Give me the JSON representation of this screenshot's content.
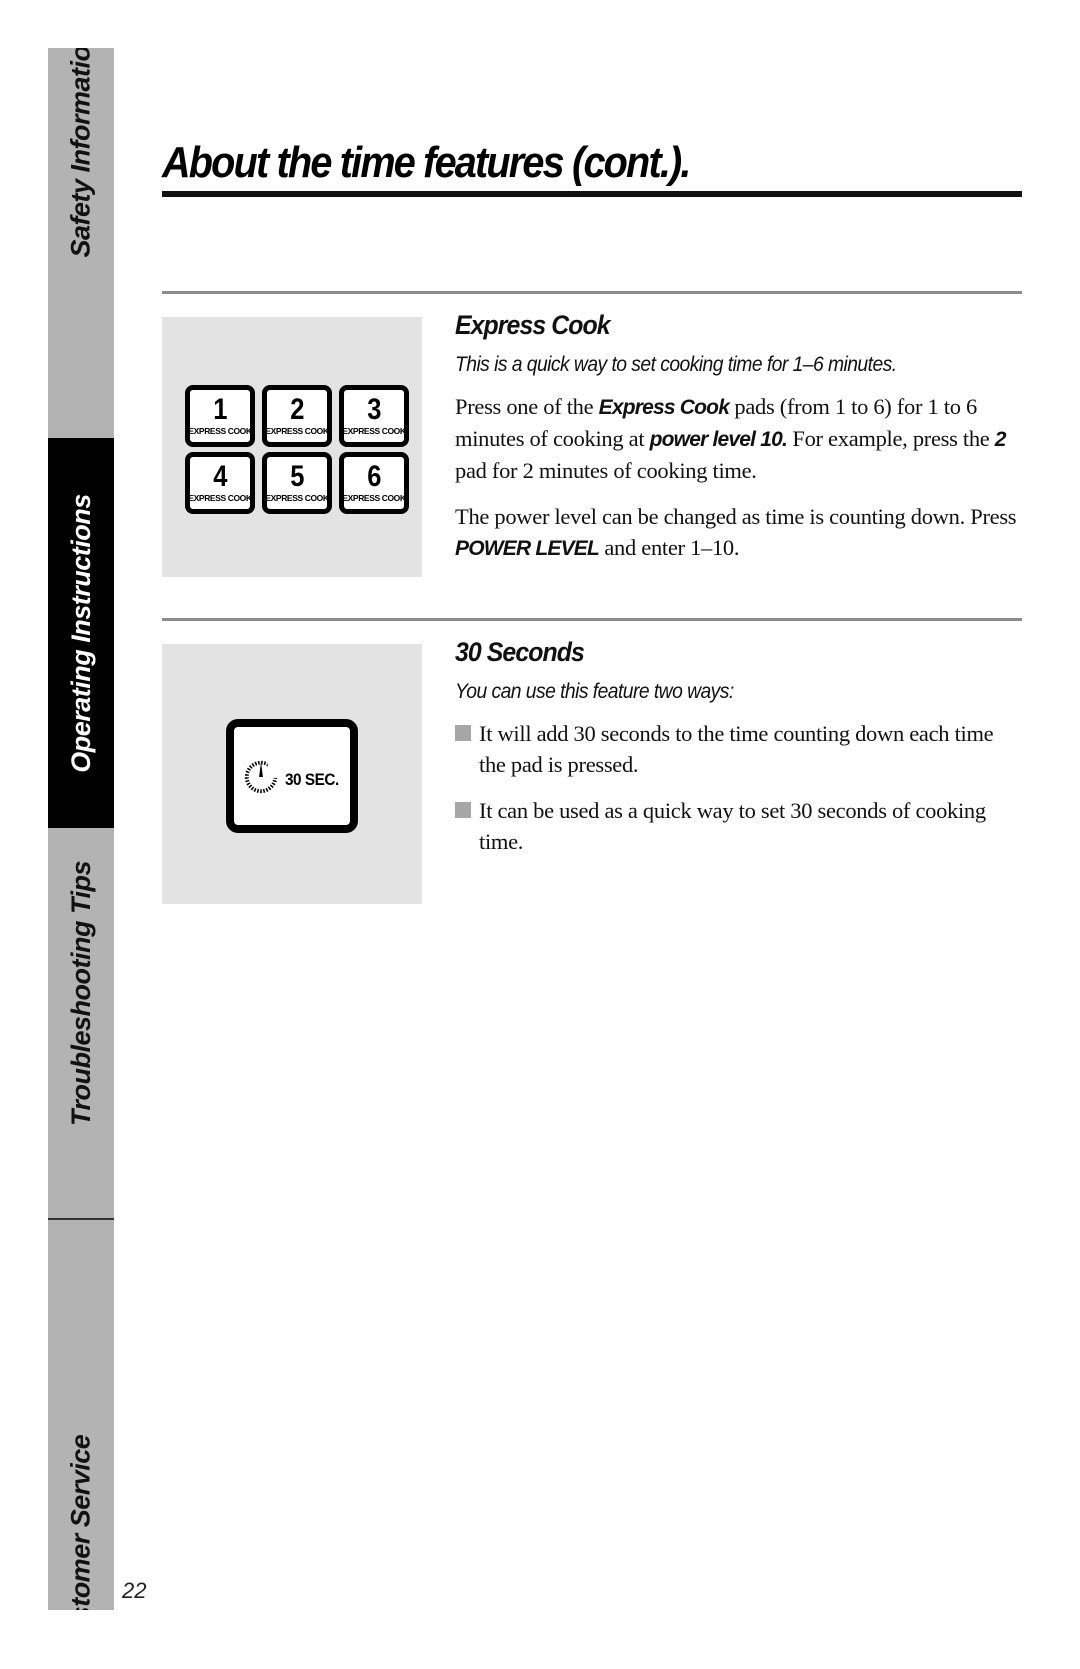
{
  "sidebar": {
    "tabs": [
      {
        "label": "Safety Information",
        "active": false
      },
      {
        "label": "Operating Instructions",
        "active": true
      },
      {
        "label": "Troubleshooting Tips",
        "active": false
      },
      {
        "label": "Customer Service",
        "active": false
      }
    ]
  },
  "page": {
    "title": "About the time features (cont.).",
    "number": "22"
  },
  "express_cook": {
    "heading": "Express Cook",
    "subhead": "This is a quick way to set cooking time for 1–6 minutes.",
    "pads": [
      {
        "number": "1",
        "caption": "EXPRESS COOK"
      },
      {
        "number": "2",
        "caption": "EXPRESS COOK"
      },
      {
        "number": "3",
        "caption": "EXPRESS COOK"
      },
      {
        "number": "4",
        "caption": "EXPRESS COOK"
      },
      {
        "number": "5",
        "caption": "EXPRESS COOK"
      },
      {
        "number": "6",
        "caption": "EXPRESS COOK"
      }
    ],
    "para1": {
      "t1": "Press one of the ",
      "e1": "Express Cook",
      "t2": " pads (from 1 to 6) for 1 to 6 minutes of cooking at ",
      "e2": "power level 10.",
      "t3": " For example, press the ",
      "e3": "2",
      "t4": " pad for 2 minutes of cooking time."
    },
    "para2": {
      "t1": "The power level can be changed as time is counting down. Press ",
      "e1": "POWER LEVEL",
      "t2": " and enter 1–10."
    }
  },
  "thirty_seconds": {
    "heading": "30 Seconds",
    "subhead": "You can use this feature two ways:",
    "pad_label": "30 SEC.",
    "bullets": [
      "It will add 30 seconds to the time counting down each time the pad is pressed.",
      "It can be used as a quick way to set 30 seconds of cooking time."
    ]
  }
}
